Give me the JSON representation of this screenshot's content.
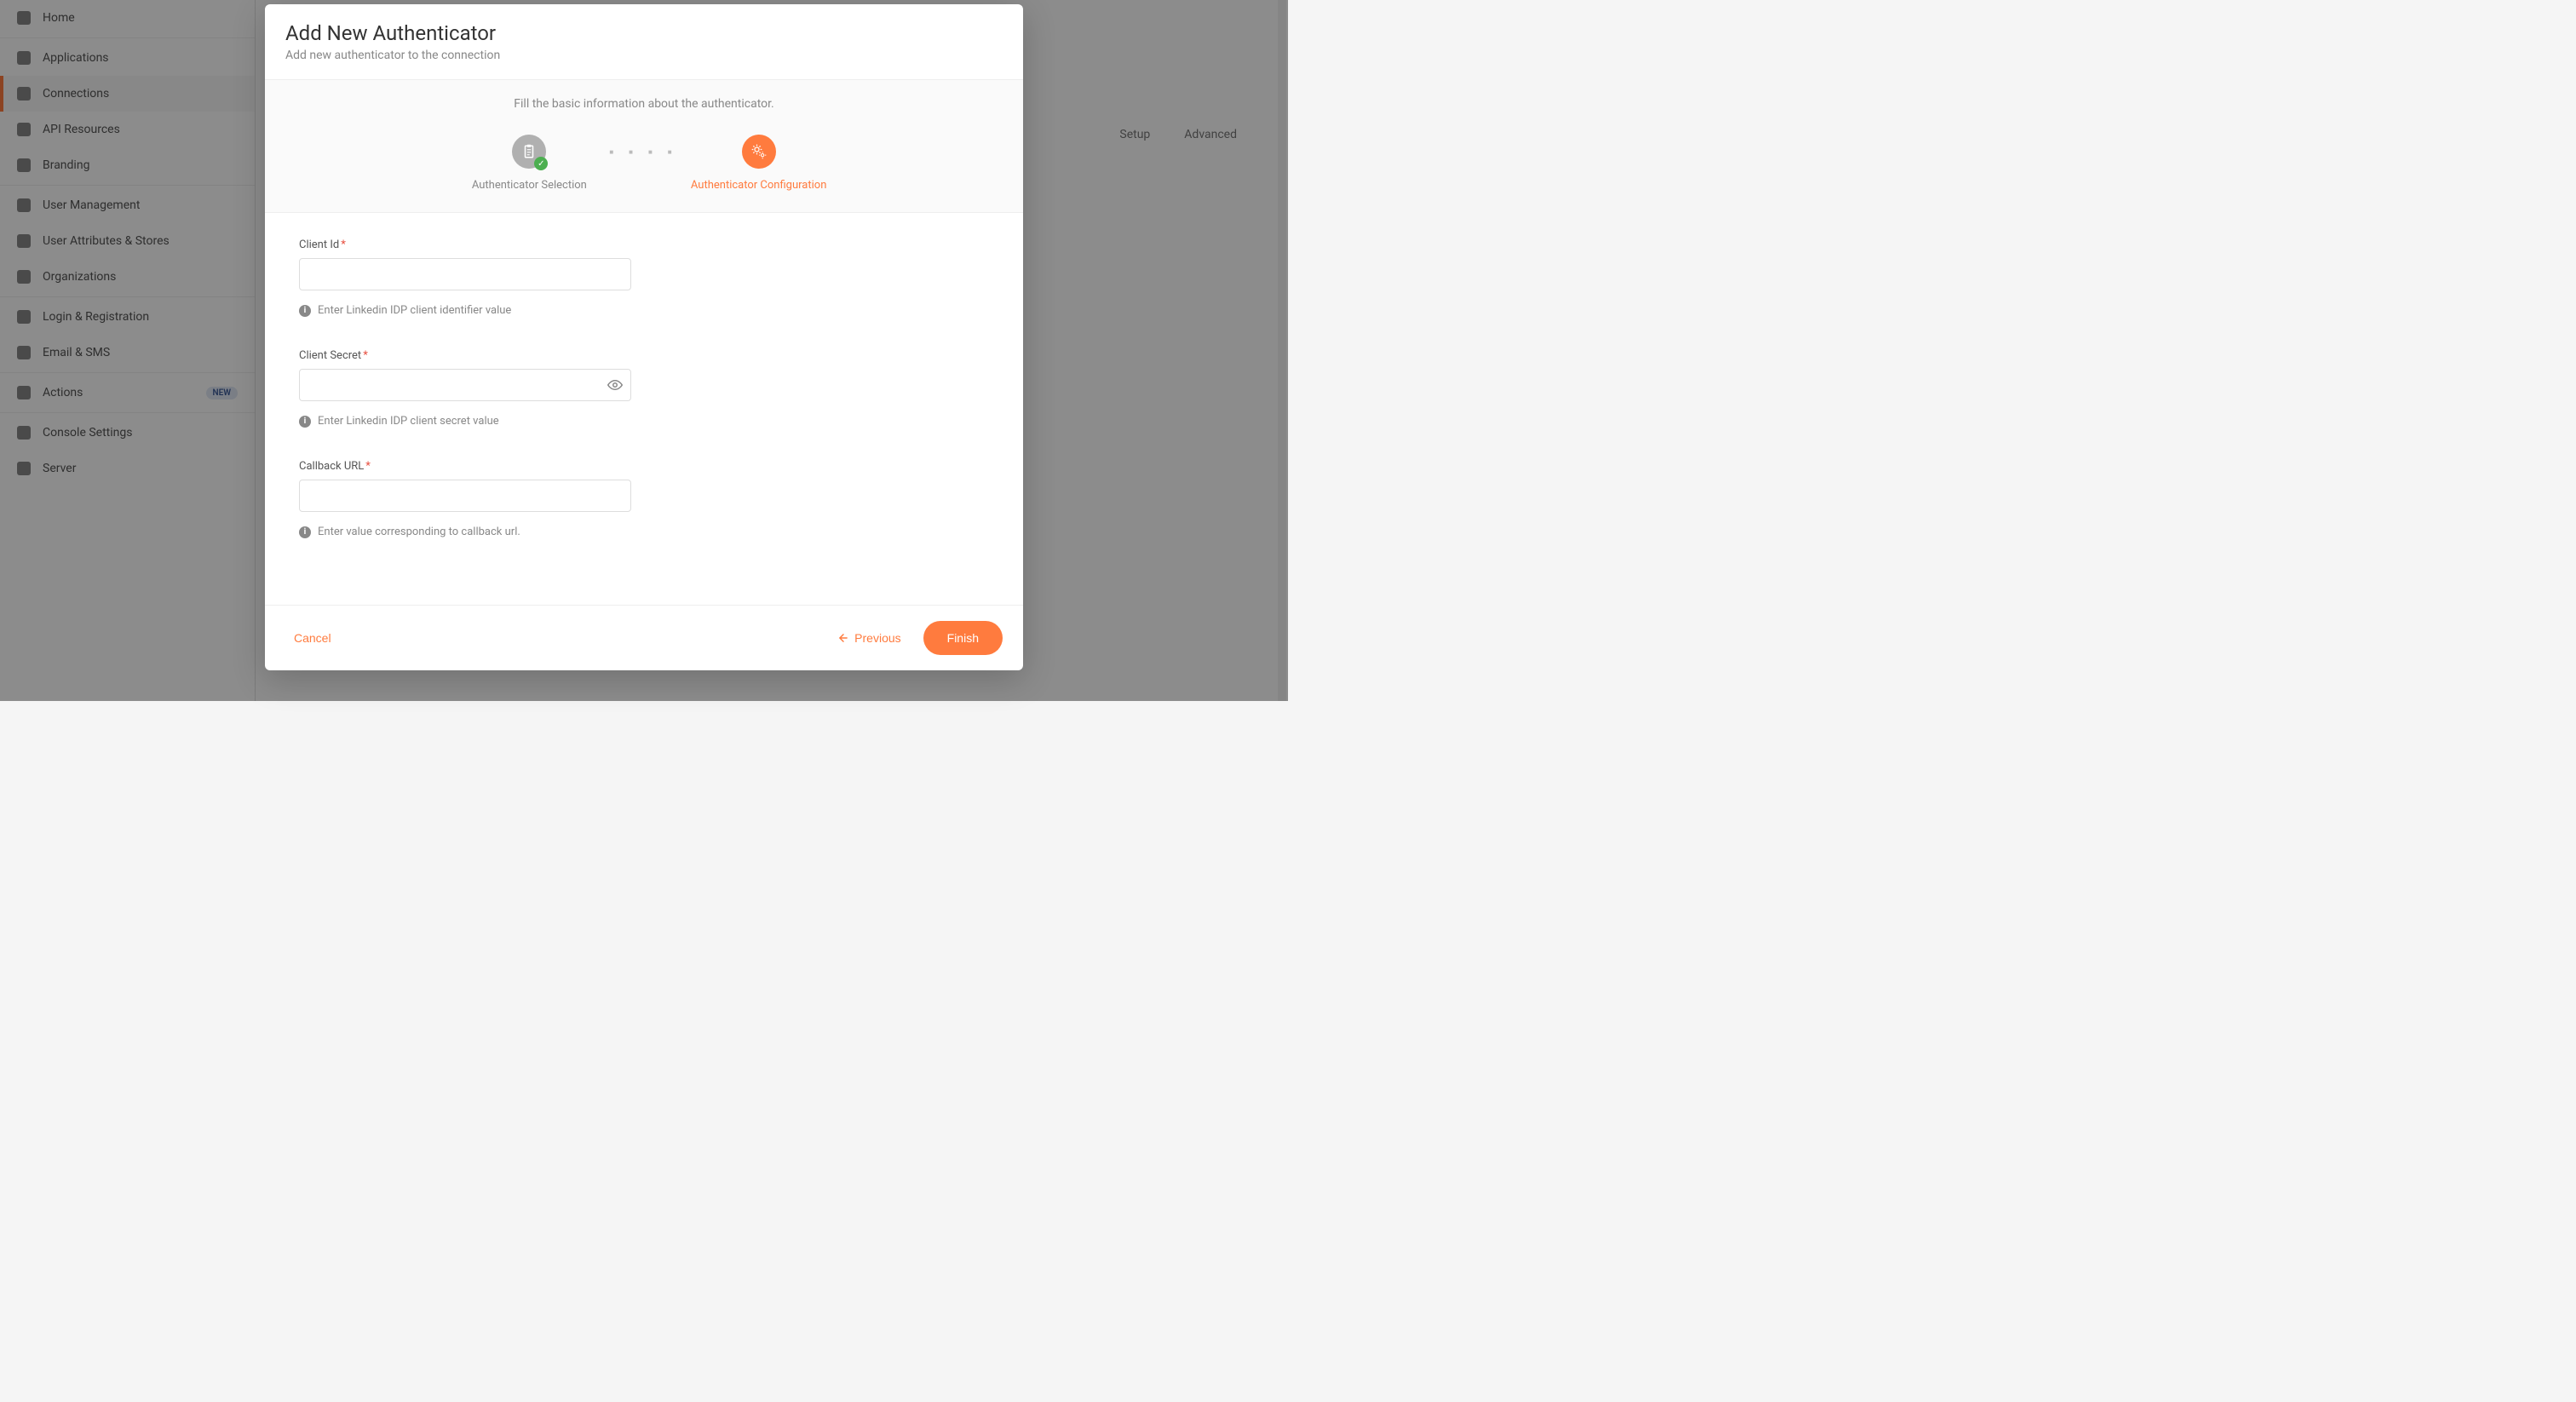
{
  "sidebar": {
    "items": [
      {
        "label": "Home"
      },
      {
        "label": "Applications"
      },
      {
        "label": "Connections"
      },
      {
        "label": "API Resources"
      },
      {
        "label": "Branding"
      },
      {
        "label": "User Management"
      },
      {
        "label": "User Attributes & Stores"
      },
      {
        "label": "Organizations"
      },
      {
        "label": "Login & Registration"
      },
      {
        "label": "Email & SMS"
      },
      {
        "label": "Actions",
        "badge": "NEW"
      },
      {
        "label": "Console Settings"
      },
      {
        "label": "Server"
      }
    ],
    "active_index": 2
  },
  "background_tabs": [
    "Setup",
    "Advanced"
  ],
  "modal": {
    "title": "Add New Authenticator",
    "subtitle": "Add new authenticator to the connection",
    "hint": "Fill the basic information about the authenticator.",
    "steps": {
      "step1": "Authenticator Selection",
      "step2": "Authenticator Configuration"
    },
    "form": {
      "client_id": {
        "label": "Client Id",
        "value": "",
        "hint": "Enter Linkedin IDP client identifier value"
      },
      "client_secret": {
        "label": "Client Secret",
        "value": "",
        "hint": "Enter Linkedin IDP client secret value"
      },
      "callback_url": {
        "label": "Callback URL",
        "value": "",
        "hint": "Enter value corresponding to callback url."
      }
    },
    "buttons": {
      "cancel": "Cancel",
      "previous": "Previous",
      "finish": "Finish"
    }
  }
}
